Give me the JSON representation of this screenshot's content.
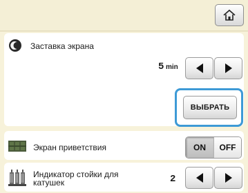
{
  "header": {
    "home_icon": "home-icon"
  },
  "screensaver": {
    "icon": "screensaver-icon",
    "label": "Заставка экрана",
    "value": "5",
    "unit": "min",
    "decrease_icon": "arrow-left-icon",
    "increase_icon": "arrow-right-icon",
    "select_label": "ВЫБРАТЬ"
  },
  "welcome": {
    "icon": "welcome-screen-icon",
    "label": "Экран приветствия",
    "on_label": "ON",
    "off_label": "OFF",
    "state": "ON"
  },
  "spool_indicator": {
    "icon": "spool-stand-icon",
    "label_line1": "Индикатор стойки для",
    "label_line2": "катушек",
    "value": "2",
    "decrease_icon": "arrow-left-icon",
    "increase_icon": "arrow-right-icon"
  },
  "colors": {
    "background": "#f7f2da",
    "panel": "#ffffff",
    "focus_ring": "#3d9ad6"
  }
}
